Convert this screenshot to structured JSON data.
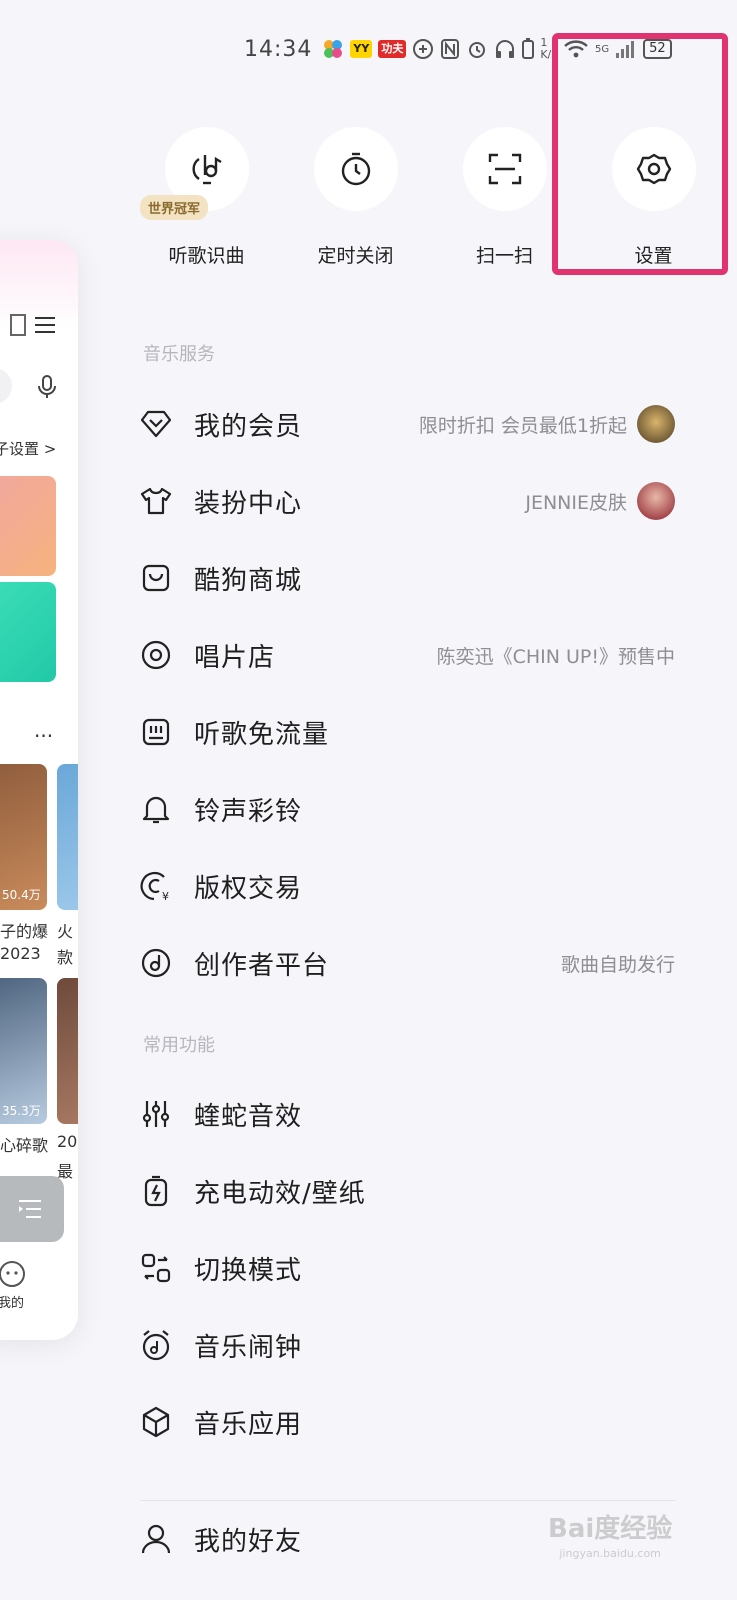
{
  "status_bar": {
    "time": "14:34",
    "app_badge_1": "YY",
    "app_badge_2": "功夫",
    "speed_top": "1",
    "speed_bottom": "K/s",
    "network": "5G",
    "battery": "52"
  },
  "quick_actions": [
    {
      "label": "听歌识曲",
      "icon": "music-recognition-icon",
      "badge": "世界冠军"
    },
    {
      "label": "定时关闭",
      "icon": "timer-icon"
    },
    {
      "label": "扫一扫",
      "icon": "scan-icon"
    },
    {
      "label": "设置",
      "icon": "gear-icon"
    }
  ],
  "highlight_color": "#e0336f",
  "sections": {
    "music_services": "音乐服务",
    "common_functions": "常用功能"
  },
  "menu": {
    "membership": {
      "label": "我的会员",
      "right": "限时折扣 会员最低1折起"
    },
    "dress_up": {
      "label": "装扮中心",
      "right": "JENNIE皮肤"
    },
    "mall": {
      "label": "酷狗商城"
    },
    "record_store": {
      "label": "唱片店",
      "right": "陈奕迅《CHIN UP!》预售中"
    },
    "free_data": {
      "label": "听歌免流量"
    },
    "ringtone": {
      "label": "铃声彩铃"
    },
    "copyright": {
      "label": "版权交易"
    },
    "creator": {
      "label": "创作者平台",
      "right": "歌曲自助发行"
    },
    "sound_effect": {
      "label": "蝰蛇音效"
    },
    "charging": {
      "label": "充电动效/壁纸"
    },
    "switch_mode": {
      "label": "切换模式"
    },
    "alarm": {
      "label": "音乐闹钟"
    },
    "music_apps": {
      "label": "音乐应用"
    },
    "friends": {
      "label": "我的好友"
    }
  },
  "preview": {
    "settings_link": "子设置 >",
    "more": "...",
    "play_count_1": "50.4万",
    "play_count_2": "35.3万",
    "caption_1a": "子的爆",
    "caption_1b": "2023",
    "caption_2a": "火",
    "caption_2b": "款",
    "caption_3": "心碎歌",
    "caption_4a": "20",
    "caption_4b": "最",
    "tab_mine": "我的"
  },
  "watermark": {
    "text": "Bai度经验",
    "url": "jingyan.baidu.com"
  }
}
